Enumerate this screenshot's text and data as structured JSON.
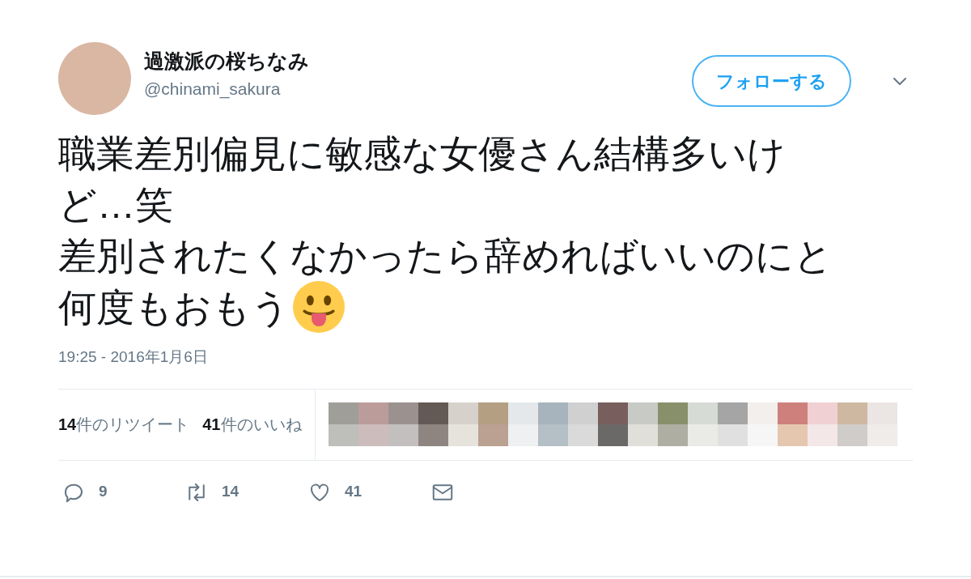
{
  "author": {
    "name": "過激派の桜ちなみ",
    "handle": "@chinami_sakura"
  },
  "follow_button": {
    "label": "フォローする"
  },
  "tweet": {
    "lines": [
      "職業差別偏見に敏感な女優さん結構多いけど…笑",
      "差別されたくなかったら辞めればいいのにと",
      "何度もおもう"
    ]
  },
  "timestamp": "19:25 - 2016年1月6日",
  "stats": [
    {
      "text": "**14**件のリツイート"
    },
    {
      "text": "**41**件のいいね"
    }
  ],
  "actions": [
    {
      "kind": "reply",
      "count": "9"
    },
    {
      "kind": "retweet",
      "count": "14"
    },
    {
      "kind": "like",
      "count": "41"
    },
    {
      "kind": "message"
    }
  ]
}
